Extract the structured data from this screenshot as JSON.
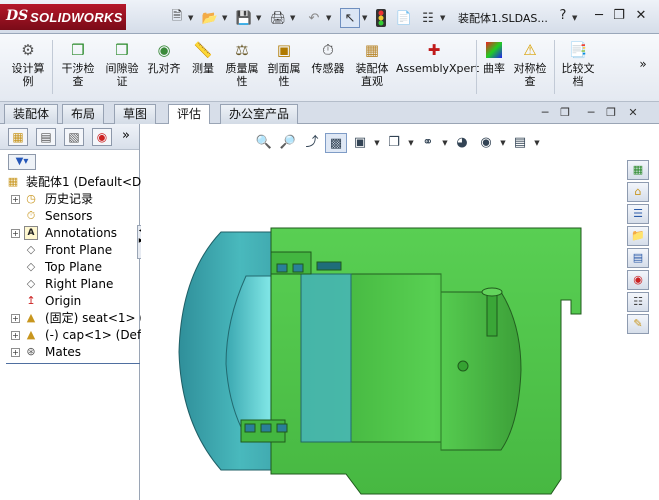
{
  "app": {
    "logo_ds": "DS",
    "logo_name": "SOLIDWORKS",
    "document_title": "装配体1.SLDAS...",
    "help_label": "?"
  },
  "toolbar": {
    "icons": [
      "new-icon",
      "open-icon",
      "save-icon",
      "print-icon",
      "undo-icon",
      "select-icon",
      "traffic-light-icon",
      "file-properties-icon",
      "options-icon"
    ]
  },
  "ribbon": {
    "items": [
      {
        "label": "设计算例",
        "icon": "design-study-icon"
      },
      {
        "label": "干涉检查",
        "icon": "interference-check-icon"
      },
      {
        "label": "间隙验证",
        "icon": "clearance-verification-icon"
      },
      {
        "label": "孔对齐",
        "icon": "hole-alignment-icon"
      },
      {
        "label": "测量",
        "icon": "measure-icon"
      },
      {
        "label": "质量属性",
        "icon": "mass-properties-icon"
      },
      {
        "label": "剖面属性",
        "icon": "section-properties-icon"
      },
      {
        "label": "传感器",
        "icon": "sensor-icon"
      },
      {
        "label": "装配体直观",
        "icon": "assembly-visualization-icon"
      },
      {
        "label": "AssemblyXpert",
        "icon": "assemblyxpert-icon"
      },
      {
        "label": "曲率",
        "icon": "curvature-icon"
      },
      {
        "label": "对称检查",
        "icon": "symmetry-check-icon"
      },
      {
        "label": "比较文档",
        "icon": "compare-documents-icon"
      }
    ]
  },
  "tabs": [
    {
      "label": "装配体"
    },
    {
      "label": "布局"
    },
    {
      "label": "草图"
    },
    {
      "label": "评估"
    },
    {
      "label": "办公室产品"
    }
  ],
  "active_tab": "评估",
  "feature_manager": {
    "root": "装配体1  (Default<Di",
    "items": [
      {
        "label": "历史记录",
        "icon": "history-icon",
        "expandable": true
      },
      {
        "label": "Sensors",
        "icon": "sensors-icon",
        "expandable": false
      },
      {
        "label": "Annotations",
        "icon": "annotations-icon",
        "expandable": true
      },
      {
        "label": "Front Plane",
        "icon": "plane-icon",
        "expandable": false
      },
      {
        "label": "Top Plane",
        "icon": "plane-icon",
        "expandable": false
      },
      {
        "label": "Right Plane",
        "icon": "plane-icon",
        "expandable": false
      },
      {
        "label": "Origin",
        "icon": "origin-icon",
        "expandable": false
      },
      {
        "label": "(固定) seat<1> (D",
        "icon": "part-icon",
        "expandable": true
      },
      {
        "label": "(-) cap<1> (Defa",
        "icon": "part-icon",
        "expandable": true
      },
      {
        "label": "Mates",
        "icon": "mates-icon",
        "expandable": true
      }
    ]
  },
  "colors": {
    "model_green": "#4fc64a",
    "model_cyan": "#3fb6b2",
    "accent": "#b5182a"
  }
}
